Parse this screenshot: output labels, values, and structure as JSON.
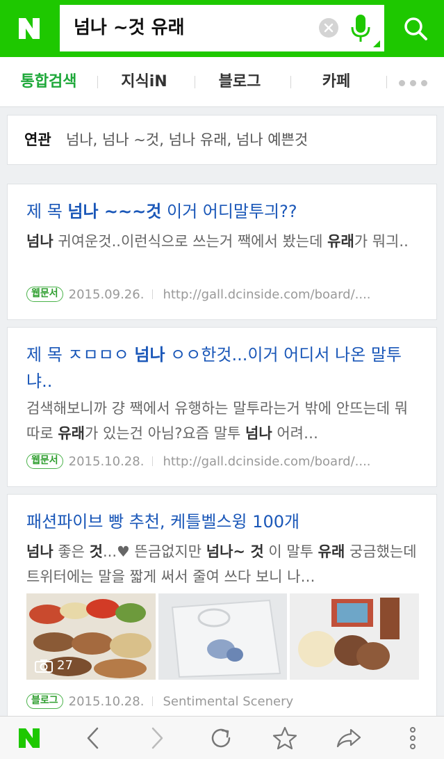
{
  "header": {
    "logo": "N",
    "query": "넘나 ~것 유래",
    "clear_icon": "clear-icon",
    "mic_icon": "mic-icon",
    "search_icon": "search-icon",
    "brand_color": "#1ec800"
  },
  "tabs": [
    {
      "label": "통합검색",
      "active": true
    },
    {
      "label": "지식iN",
      "active": false
    },
    {
      "label": "블로그",
      "active": false
    },
    {
      "label": "카페",
      "active": false
    }
  ],
  "related": {
    "label": "연관",
    "terms": "넘나, 넘나 ~것, 넘나 유래, 넘나 예쁜것"
  },
  "results": [
    {
      "title_prefix": "제 목 ",
      "title_bold": "넘나 ~~~것",
      "title_suffix": " 이거 어디말투긔??",
      "body_bold1": "넘나",
      "body_1": " 귀여운것..이런식으로 쓰는거 짹에서 봤는데 ",
      "body_bold2": "유래",
      "body_2": "가 뭐긔..",
      "badge": "웹문서",
      "date": "2015.09.26.",
      "source": "http://gall.dcinside.com/board/...."
    },
    {
      "title_prefix": "제 목 ㅈㅁㅁㅇ ",
      "title_bold": "넘나",
      "title_suffix": " ㅇㅇ한것...이거 어디서 나온 말투냐..",
      "body_1": "검색해보니까 걍 짹에서 유행하는 말투라는거 밖에 안뜨는데 뭐 따로 ",
      "body_bold2": "유래",
      "body_2": "가 있는건 아님?요즘 말투 ",
      "body_bold3": "넘나",
      "body_3": " 어려…",
      "badge": "웹문서",
      "date": "2015.10.28.",
      "source": "http://gall.dcinside.com/board/...."
    },
    {
      "title": "패션파이브 빵 추천, 케틀벨스윙 100개",
      "body_bold1": "넘나",
      "body_1": " 좋은 ",
      "body_bold2": "것",
      "body_2": "...♥ 뜬금없지만 ",
      "body_bold3": "넘나~ 것",
      "body_3": " 이 말투 ",
      "body_bold4": "유래",
      "body_4": " 궁금했는데 트위터에는 말을 짧게 써서 줄여 쓰다 보니 나…",
      "photo_count": "27",
      "badge": "블로그",
      "date": "2015.10.28.",
      "source": "Sentimental Scenery"
    }
  ],
  "bottom_bar": {
    "icons": [
      "naver-home-icon",
      "back-icon",
      "forward-icon",
      "refresh-icon",
      "bookmark-star-icon",
      "share-icon",
      "more-vertical-icon"
    ]
  }
}
